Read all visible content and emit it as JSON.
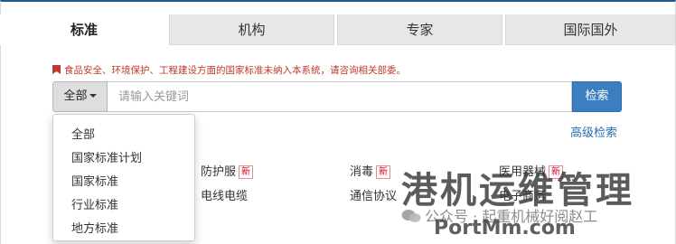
{
  "tabs": [
    {
      "label": "标准",
      "active": true
    },
    {
      "label": "机构",
      "active": false
    },
    {
      "label": "专家",
      "active": false
    },
    {
      "label": "国际国外",
      "active": false
    }
  ],
  "notice": {
    "text": "食品安全、环境保护、工程建设方面的国家标准未纳入本系统，请咨询相关部委。",
    "icon": "flag-icon",
    "color": "#c0392b"
  },
  "search": {
    "scope_label": "全部",
    "placeholder": "请输入关键词",
    "value": "",
    "button_label": "检索",
    "advanced_label": "高级检索"
  },
  "scope_dropdown": {
    "open": true,
    "options": [
      "全部",
      "国家标准计划",
      "国家标准",
      "行业标准",
      "地方标准"
    ]
  },
  "categories": [
    {
      "label": "防护服",
      "new": true
    },
    {
      "label": "消毒",
      "new": true
    },
    {
      "label": "医用器械",
      "new": true
    },
    {
      "label": "电线电缆",
      "new": false
    },
    {
      "label": "通信协议",
      "new": false
    },
    {
      "label": "电子商务",
      "new": false
    }
  ],
  "new_badge": "新",
  "watermark": {
    "title": "港机运维管理",
    "account": "公众号 · 起重机械好阅赵工",
    "url": "PortMm.com"
  },
  "colors": {
    "accent": "#3c7fc1",
    "top_border": "#1f5a8c",
    "badge": "#d0021b"
  }
}
